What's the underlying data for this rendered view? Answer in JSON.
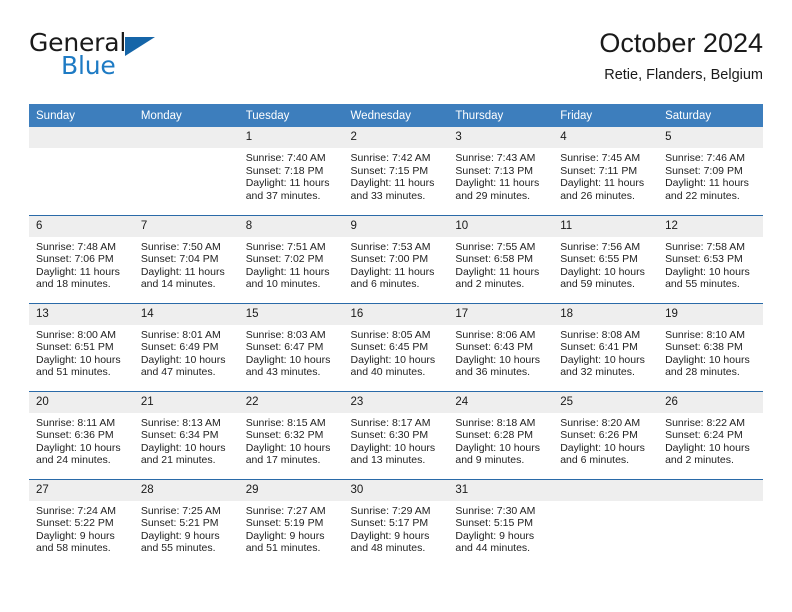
{
  "brand": {
    "word_general": "General",
    "word_blue": "Blue",
    "accent_color": "#1e7bc4",
    "triangle_color": "#1565a8"
  },
  "header": {
    "title": "October 2024",
    "location": "Retie, Flanders, Belgium"
  },
  "calendar": {
    "header_bg": "#3d7ebd",
    "daynum_bg": "#eeeeee",
    "row_divider_color": "#2a6aa8",
    "weekdays": [
      "Sunday",
      "Monday",
      "Tuesday",
      "Wednesday",
      "Thursday",
      "Friday",
      "Saturday"
    ],
    "weeks": [
      [
        {
          "day": "",
          "sunrise": "",
          "sunset": "",
          "daylight": "",
          "empty": true
        },
        {
          "day": "",
          "sunrise": "",
          "sunset": "",
          "daylight": "",
          "empty": true
        },
        {
          "day": "1",
          "sunrise": "Sunrise: 7:40 AM",
          "sunset": "Sunset: 7:18 PM",
          "daylight": "Daylight: 11 hours and 37 minutes."
        },
        {
          "day": "2",
          "sunrise": "Sunrise: 7:42 AM",
          "sunset": "Sunset: 7:15 PM",
          "daylight": "Daylight: 11 hours and 33 minutes."
        },
        {
          "day": "3",
          "sunrise": "Sunrise: 7:43 AM",
          "sunset": "Sunset: 7:13 PM",
          "daylight": "Daylight: 11 hours and 29 minutes."
        },
        {
          "day": "4",
          "sunrise": "Sunrise: 7:45 AM",
          "sunset": "Sunset: 7:11 PM",
          "daylight": "Daylight: 11 hours and 26 minutes."
        },
        {
          "day": "5",
          "sunrise": "Sunrise: 7:46 AM",
          "sunset": "Sunset: 7:09 PM",
          "daylight": "Daylight: 11 hours and 22 minutes."
        }
      ],
      [
        {
          "day": "6",
          "sunrise": "Sunrise: 7:48 AM",
          "sunset": "Sunset: 7:06 PM",
          "daylight": "Daylight: 11 hours and 18 minutes."
        },
        {
          "day": "7",
          "sunrise": "Sunrise: 7:50 AM",
          "sunset": "Sunset: 7:04 PM",
          "daylight": "Daylight: 11 hours and 14 minutes."
        },
        {
          "day": "8",
          "sunrise": "Sunrise: 7:51 AM",
          "sunset": "Sunset: 7:02 PM",
          "daylight": "Daylight: 11 hours and 10 minutes."
        },
        {
          "day": "9",
          "sunrise": "Sunrise: 7:53 AM",
          "sunset": "Sunset: 7:00 PM",
          "daylight": "Daylight: 11 hours and 6 minutes."
        },
        {
          "day": "10",
          "sunrise": "Sunrise: 7:55 AM",
          "sunset": "Sunset: 6:58 PM",
          "daylight": "Daylight: 11 hours and 2 minutes."
        },
        {
          "day": "11",
          "sunrise": "Sunrise: 7:56 AM",
          "sunset": "Sunset: 6:55 PM",
          "daylight": "Daylight: 10 hours and 59 minutes."
        },
        {
          "day": "12",
          "sunrise": "Sunrise: 7:58 AM",
          "sunset": "Sunset: 6:53 PM",
          "daylight": "Daylight: 10 hours and 55 minutes."
        }
      ],
      [
        {
          "day": "13",
          "sunrise": "Sunrise: 8:00 AM",
          "sunset": "Sunset: 6:51 PM",
          "daylight": "Daylight: 10 hours and 51 minutes."
        },
        {
          "day": "14",
          "sunrise": "Sunrise: 8:01 AM",
          "sunset": "Sunset: 6:49 PM",
          "daylight": "Daylight: 10 hours and 47 minutes."
        },
        {
          "day": "15",
          "sunrise": "Sunrise: 8:03 AM",
          "sunset": "Sunset: 6:47 PM",
          "daylight": "Daylight: 10 hours and 43 minutes."
        },
        {
          "day": "16",
          "sunrise": "Sunrise: 8:05 AM",
          "sunset": "Sunset: 6:45 PM",
          "daylight": "Daylight: 10 hours and 40 minutes."
        },
        {
          "day": "17",
          "sunrise": "Sunrise: 8:06 AM",
          "sunset": "Sunset: 6:43 PM",
          "daylight": "Daylight: 10 hours and 36 minutes."
        },
        {
          "day": "18",
          "sunrise": "Sunrise: 8:08 AM",
          "sunset": "Sunset: 6:41 PM",
          "daylight": "Daylight: 10 hours and 32 minutes."
        },
        {
          "day": "19",
          "sunrise": "Sunrise: 8:10 AM",
          "sunset": "Sunset: 6:38 PM",
          "daylight": "Daylight: 10 hours and 28 minutes."
        }
      ],
      [
        {
          "day": "20",
          "sunrise": "Sunrise: 8:11 AM",
          "sunset": "Sunset: 6:36 PM",
          "daylight": "Daylight: 10 hours and 24 minutes."
        },
        {
          "day": "21",
          "sunrise": "Sunrise: 8:13 AM",
          "sunset": "Sunset: 6:34 PM",
          "daylight": "Daylight: 10 hours and 21 minutes."
        },
        {
          "day": "22",
          "sunrise": "Sunrise: 8:15 AM",
          "sunset": "Sunset: 6:32 PM",
          "daylight": "Daylight: 10 hours and 17 minutes."
        },
        {
          "day": "23",
          "sunrise": "Sunrise: 8:17 AM",
          "sunset": "Sunset: 6:30 PM",
          "daylight": "Daylight: 10 hours and 13 minutes."
        },
        {
          "day": "24",
          "sunrise": "Sunrise: 8:18 AM",
          "sunset": "Sunset: 6:28 PM",
          "daylight": "Daylight: 10 hours and 9 minutes."
        },
        {
          "day": "25",
          "sunrise": "Sunrise: 8:20 AM",
          "sunset": "Sunset: 6:26 PM",
          "daylight": "Daylight: 10 hours and 6 minutes."
        },
        {
          "day": "26",
          "sunrise": "Sunrise: 8:22 AM",
          "sunset": "Sunset: 6:24 PM",
          "daylight": "Daylight: 10 hours and 2 minutes."
        }
      ],
      [
        {
          "day": "27",
          "sunrise": "Sunrise: 7:24 AM",
          "sunset": "Sunset: 5:22 PM",
          "daylight": "Daylight: 9 hours and 58 minutes."
        },
        {
          "day": "28",
          "sunrise": "Sunrise: 7:25 AM",
          "sunset": "Sunset: 5:21 PM",
          "daylight": "Daylight: 9 hours and 55 minutes."
        },
        {
          "day": "29",
          "sunrise": "Sunrise: 7:27 AM",
          "sunset": "Sunset: 5:19 PM",
          "daylight": "Daylight: 9 hours and 51 minutes."
        },
        {
          "day": "30",
          "sunrise": "Sunrise: 7:29 AM",
          "sunset": "Sunset: 5:17 PM",
          "daylight": "Daylight: 9 hours and 48 minutes."
        },
        {
          "day": "31",
          "sunrise": "Sunrise: 7:30 AM",
          "sunset": "Sunset: 5:15 PM",
          "daylight": "Daylight: 9 hours and 44 minutes."
        },
        {
          "day": "",
          "sunrise": "",
          "sunset": "",
          "daylight": "",
          "empty": true
        },
        {
          "day": "",
          "sunrise": "",
          "sunset": "",
          "daylight": "",
          "empty": true
        }
      ]
    ]
  }
}
